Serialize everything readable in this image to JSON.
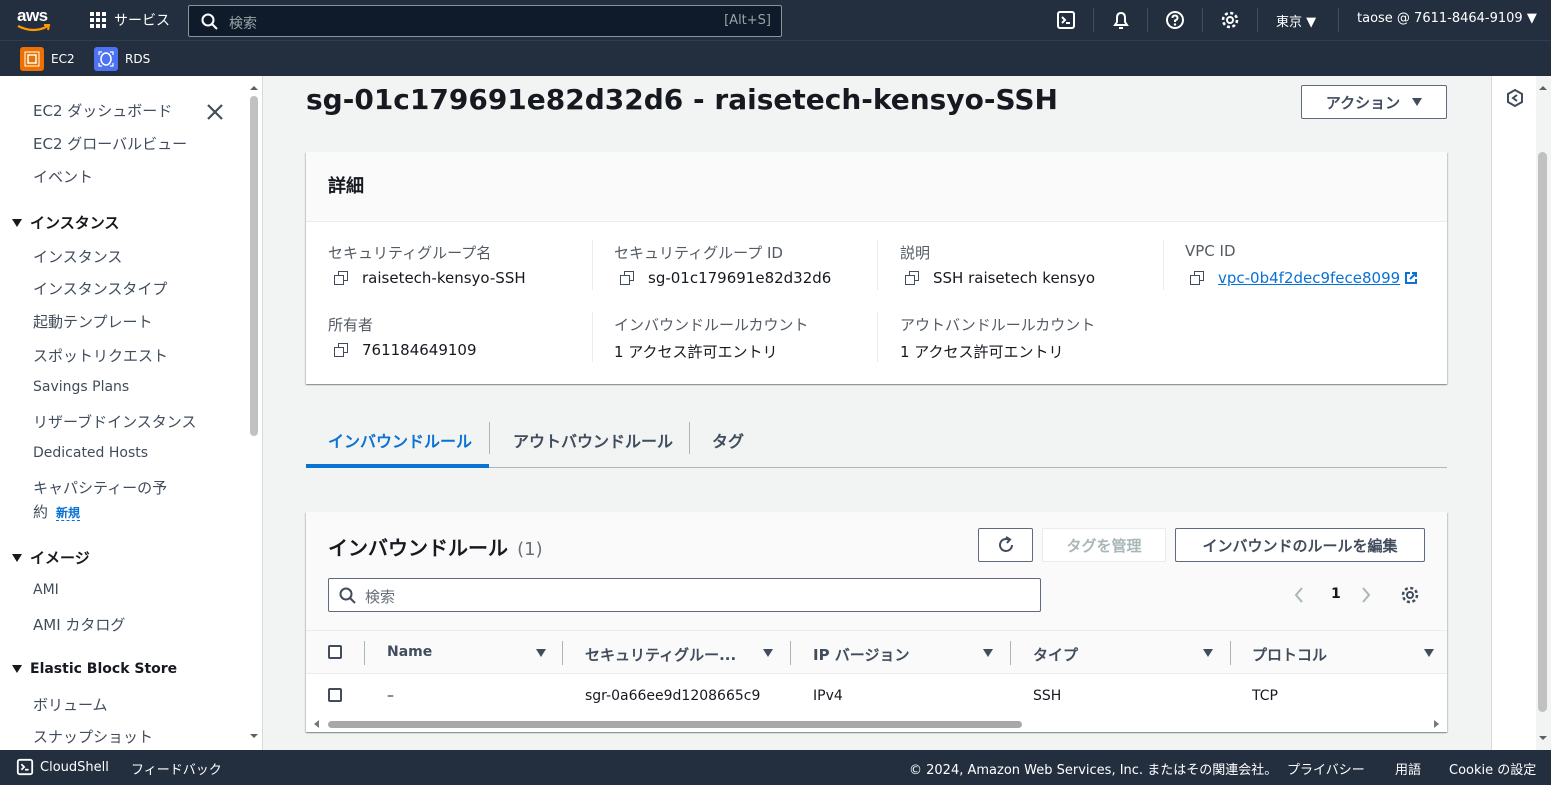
{
  "topbar": {
    "logo_text": "aws",
    "services_label": "サービス",
    "search_placeholder": "検索",
    "search_shortcut": "[Alt+S]",
    "region": "東京 ▼",
    "account": "taose @ 7611-8464-9109 ▼",
    "icons": [
      "cloudshell-icon",
      "bell-icon",
      "help-icon",
      "gear-icon"
    ]
  },
  "favorites": [
    {
      "label": "EC2",
      "color": "#ed7100"
    },
    {
      "label": "RDS",
      "color": "#4d72f3"
    }
  ],
  "sidebar": {
    "items": [
      "EC2 ダッシュボード",
      "EC2 グローバルビュー",
      "イベント"
    ],
    "section_instances": "インスタンス",
    "instances_items": [
      "インスタンス",
      "インスタンスタイプ",
      "起動テンプレート",
      "スポットリクエスト",
      "Savings Plans",
      "リザーブドインスタンス",
      "Dedicated Hosts"
    ],
    "capacity_line1": "キャパシティーの予",
    "capacity_line2": "約",
    "new_badge": "新規",
    "section_images": "イメージ",
    "images_items": [
      "AMI",
      "AMI カタログ"
    ],
    "section_ebs": "Elastic Block Store",
    "ebs_items": [
      "ボリューム",
      "スナップショット"
    ]
  },
  "page": {
    "title": "sg-01c179691e82d32d6 - raisetech-kensyo-SSH",
    "actions_button": "アクション"
  },
  "details": {
    "title": "詳細",
    "sg_name_label": "セキュリティグループ名",
    "sg_name_value": "raisetech-kensyo-SSH",
    "sg_id_label": "セキュリティグループ ID",
    "sg_id_value": "sg-01c179691e82d32d6",
    "desc_label": "説明",
    "desc_value": "SSH raisetech kensyo",
    "vpc_label": "VPC ID",
    "vpc_value": "vpc-0b4f2dec9fece8099",
    "owner_label": "所有者",
    "owner_value": "761184649109",
    "inbound_count_label": "インバウンドルールカウント",
    "inbound_count_value": "1 アクセス許可エントリ",
    "outbound_count_label": "アウトバンドルールカウント",
    "outbound_count_value": "1 アクセス許可エントリ"
  },
  "tabs": [
    "インバウンドルール",
    "アウトバウンドルール",
    "タグ"
  ],
  "rules": {
    "title": "インバウンドルール",
    "count": "(1)",
    "manage_tags_button": "タグを管理",
    "edit_button": "インバウンドのルールを編集",
    "search_placeholder": "検索",
    "page_number": "1",
    "columns": [
      "Name",
      "セキュリティグルー...",
      "IP バージョン",
      "タイプ",
      "プロトコル"
    ],
    "rows": [
      {
        "name": "–",
        "rule_id": "sgr-0a66ee9d1208665c9",
        "ip_version": "IPv4",
        "type": "SSH",
        "protocol": "TCP"
      }
    ]
  },
  "footer": {
    "cloudshell": "CloudShell",
    "feedback": "フィードバック",
    "copyright": "© 2024, Amazon Web Services, Inc. またはその関連会社。",
    "privacy": "プライバシー",
    "terms": "用語",
    "cookie": "Cookie の設定"
  }
}
